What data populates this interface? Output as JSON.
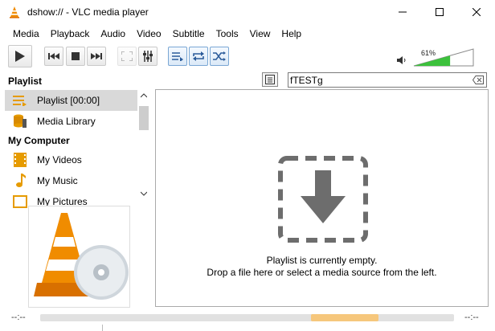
{
  "window": {
    "title": "dshow:// - VLC media player",
    "app_icon": "vlc-cone-icon",
    "controls": [
      "minimize-icon",
      "maximize-icon",
      "close-icon"
    ]
  },
  "menu": {
    "items": [
      "Media",
      "Playback",
      "Audio",
      "Video",
      "Subtitle",
      "Tools",
      "View",
      "Help"
    ]
  },
  "toolbar": {
    "buttons": [
      "play-icon",
      "previous-icon",
      "stop-icon",
      "next-icon",
      "fullscreen-icon",
      "extended-settings-icon",
      "playlist-toggle-icon",
      "loop-icon",
      "random-icon"
    ],
    "volume_percent": "61%",
    "volume_level": 0.61
  },
  "sidebar": {
    "playlist_heading": "Playlist",
    "items": [
      {
        "label": "Playlist [00:00]",
        "icon": "playlist-icon",
        "selected": true
      },
      {
        "label": "Media Library",
        "icon": "media-library-icon",
        "selected": false
      }
    ],
    "computer_heading": "My Computer",
    "computer_items": [
      {
        "label": "My Videos",
        "icon": "film-icon"
      },
      {
        "label": "My Music",
        "icon": "music-note-icon"
      },
      {
        "label": "My Pictures",
        "icon": "picture-icon"
      }
    ]
  },
  "search": {
    "value": "fTESTg"
  },
  "playlist": {
    "empty_line1": "Playlist is currently empty.",
    "empty_line2": "Drop a file here or select a media source from the left."
  },
  "status": {
    "time_elapsed": "--:--",
    "time_total": "--:--"
  },
  "colors": {
    "accent_orange": "#f08c00",
    "volume_green": "#3cc13c",
    "seek_handle": "#f6c77c",
    "selection_gray": "#d9d9d9"
  }
}
